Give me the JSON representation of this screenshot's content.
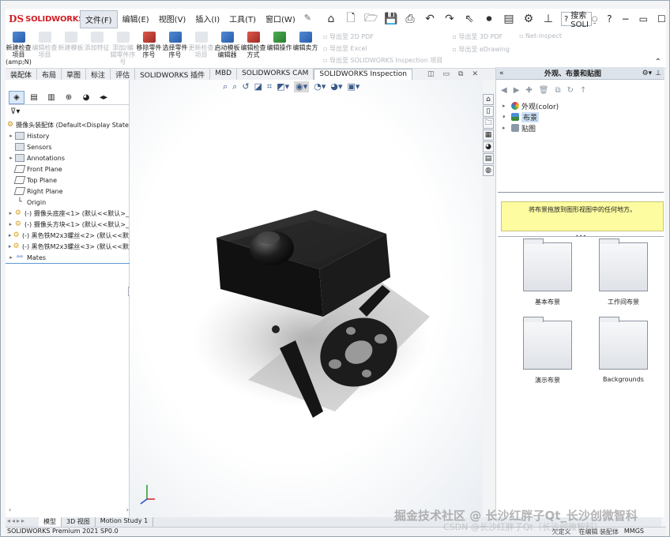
{
  "app": {
    "brand": "SOLIDWORKS",
    "brand_mark": "DS"
  },
  "menu": [
    {
      "label": "文件(F)",
      "active": true
    },
    {
      "label": "编辑(E)",
      "active": false
    },
    {
      "label": "视图(V)",
      "active": false
    },
    {
      "label": "插入(I)",
      "active": false
    },
    {
      "label": "工具(T)",
      "active": false
    },
    {
      "label": "窗口(W)",
      "active": false
    }
  ],
  "search": {
    "placeholder": "搜索 SOLI"
  },
  "ribbon": {
    "buttons": [
      {
        "label": "新建检查项目(amp;N)",
        "enabled": true,
        "icon": "new-inspection-icon"
      },
      {
        "label": "编辑检查项目",
        "enabled": false,
        "icon": "edit-inspection-icon"
      },
      {
        "label": "新建模板",
        "enabled": false,
        "icon": "new-template-icon"
      },
      {
        "label": "添加特征",
        "enabled": false,
        "icon": "add-feature-icon"
      },
      {
        "label": "添加/编辑零件序号",
        "enabled": false,
        "icon": "add-balloon-icon"
      },
      {
        "label": "移除零件序号",
        "enabled": true,
        "icon": "remove-balloon-icon"
      },
      {
        "label": "选择零件序号",
        "enabled": true,
        "icon": "select-balloon-icon"
      },
      {
        "label": "更新检查项目",
        "enabled": false,
        "icon": "update-inspection-icon"
      },
      {
        "label": "启动模板编辑器",
        "enabled": true,
        "icon": "template-editor-icon"
      },
      {
        "label": "编辑检查方式",
        "enabled": true,
        "icon": "edit-method-icon"
      },
      {
        "label": "编辑操作",
        "enabled": true,
        "icon": "edit-operation-icon"
      },
      {
        "label": "编辑卖方",
        "enabled": true,
        "icon": "edit-vendor-icon"
      }
    ],
    "export_col1": [
      "导出至 2D PDF",
      "导出至 Excel",
      "导出至 SOLIDWORKS Inspection 项目"
    ],
    "export_col2": [
      "导出至 3D PDF",
      "导出至 eDrawing"
    ],
    "export_col3": [
      "Net-inspect"
    ]
  },
  "tabs": [
    {
      "label": "装配体",
      "active": false
    },
    {
      "label": "布局",
      "active": false
    },
    {
      "label": "草图",
      "active": false
    },
    {
      "label": "标注",
      "active": false
    },
    {
      "label": "评估",
      "active": false
    },
    {
      "label": "SOLIDWORKS 插件",
      "active": false
    },
    {
      "label": "MBD",
      "active": false
    },
    {
      "label": "SOLIDWORKS CAM",
      "active": false
    },
    {
      "label": "SOLIDWORKS Inspection",
      "active": true
    }
  ],
  "feature_tree": {
    "root": "摄像头装配体 (Default<Display State-",
    "items": [
      {
        "label": "History",
        "icon": "history-folder-icon",
        "expand": "▸"
      },
      {
        "label": "Sensors",
        "icon": "sensors-folder-icon",
        "expand": ""
      },
      {
        "label": "Annotations",
        "icon": "annotations-folder-icon",
        "expand": "▸"
      },
      {
        "label": "Front Plane",
        "icon": "plane-icon",
        "expand": ""
      },
      {
        "label": "Top Plane",
        "icon": "plane-icon",
        "expand": ""
      },
      {
        "label": "Right Plane",
        "icon": "plane-icon",
        "expand": ""
      },
      {
        "label": "Origin",
        "icon": "origin-icon",
        "expand": ""
      },
      {
        "label": "(-) 摄像头底座<1> (默认<<默认>_",
        "icon": "part-icon",
        "expand": "▸"
      },
      {
        "label": "(-) 摄像头方块<1> (默认<<默认>_",
        "icon": "part-icon",
        "expand": "▸"
      },
      {
        "label": "(-) 黑色铁M2x3螺丝<2> (默认<<默",
        "icon": "part-icon",
        "expand": "▸"
      },
      {
        "label": "(-) 黑色铁M2x3螺丝<3> (默认<<默",
        "icon": "part-icon",
        "expand": "▸"
      },
      {
        "label": "Mates",
        "icon": "mates-icon",
        "expand": "▸"
      }
    ]
  },
  "task_pane": {
    "title": "外观、布景和贴图",
    "tree": [
      {
        "label": "外观(color)",
        "color": "#e0b030",
        "selected": false
      },
      {
        "label": "布景",
        "color": "#3a8a3a",
        "selected": true
      },
      {
        "label": "贴图",
        "color": "#8a98a8",
        "selected": false
      }
    ],
    "hint": "将布景拖放到图形视图中的任何地方。",
    "folders": [
      "基本布景",
      "工作间布景",
      "演示布景",
      "Backgrounds"
    ]
  },
  "bottom_tabs": [
    {
      "label": "模型",
      "active": true
    },
    {
      "label": "3D 视图",
      "active": false
    },
    {
      "label": "Motion Study 1",
      "active": false
    }
  ],
  "status": {
    "left": "SOLIDWORKS Premium 2021 SP0.0",
    "underdefined": "欠定义",
    "editing": "在编辑 装配体",
    "units": "MMGS"
  },
  "watermark": {
    "line1": "掘金技术社区 @ 长沙红胖子Qt_长沙创微智科",
    "line2": "CSDN @长沙红胖子Qt（长沙创微智科）"
  },
  "colors": {
    "brand": "#d21f26",
    "accent": "#5a9ad6",
    "hint_bg": "#fdfca0"
  }
}
